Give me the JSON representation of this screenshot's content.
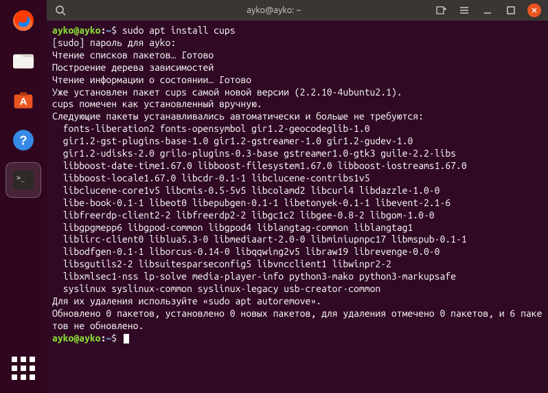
{
  "titlebar": {
    "title": "ayko@ayko: ~"
  },
  "prompt": {
    "user_host": "ayko@ayko",
    "colon": ":",
    "path": "~",
    "dollar": "$ "
  },
  "command1": "sudo apt install cups",
  "output_lines": [
    "[sudo] пароль для ayko:",
    "Чтение списков пакетов… Готово",
    "Построение дерева зависимостей",
    "Чтение информации о состоянии… Готово",
    "Уже установлен пакет cups самой новой версии (2.2.10-4ubuntu2.1).",
    "cups помечен как установленный вручную.",
    "Следующие пакеты устанавливались автоматически и больше не требуются:",
    "  fonts-liberation2 fonts-opensymbol gir1.2-geocodeglib-1.0",
    "  gir1.2-gst-plugins-base-1.0 gir1.2-gstreamer-1.0 gir1.2-gudev-1.0",
    "  gir1.2-udisks-2.0 grilo-plugins-0.3-base gstreamer1.0-gtk3 guile-2.2-libs",
    "  libboost-date-time1.67.0 libboost-filesystem1.67.0 libboost-iostreams1.67.0",
    "  libboost-locale1.67.0 libcdr-0.1-1 libclucene-contribs1v5",
    "  libclucene-core1v5 libcmis-0.5-5v5 libcolamd2 libcurl4 libdazzle-1.0-0",
    "  libe-book-0.1-1 libeot0 libepubgen-0.1-1 libetonyek-0.1-1 libevent-2.1-6",
    "  libfreerdp-client2-2 libfreerdp2-2 libgc1c2 libgee-0.8-2 libgom-1.0-0",
    "  libgpgmepp6 libgpod-common libgpod4 liblangtag-common liblangtag1",
    "  liblirc-client0 liblua5.3-0 libmediaart-2.0-0 libminiupnpc17 libmspub-0.1-1",
    "  libodfgen-0.1-1 liborcus-0.14-0 libqqwing2v5 libraw19 librevenge-0.0-0",
    "  libsgutils2-2 libsuitesparseconfig5 libvncclient1 libwinpr2-2",
    "  libxmlsec1-nss lp-solve media-player-info python3-mako python3-markupsafe",
    "  syslinux syslinux-common syslinux-legacy usb-creator-common",
    "Для их удаления используйте «sudo apt autoremove».",
    "Обновлено 0 пакетов, установлено 0 новых пакетов, для удаления отмечено 0 пакетов, и 6 пакетов не обновлено."
  ]
}
